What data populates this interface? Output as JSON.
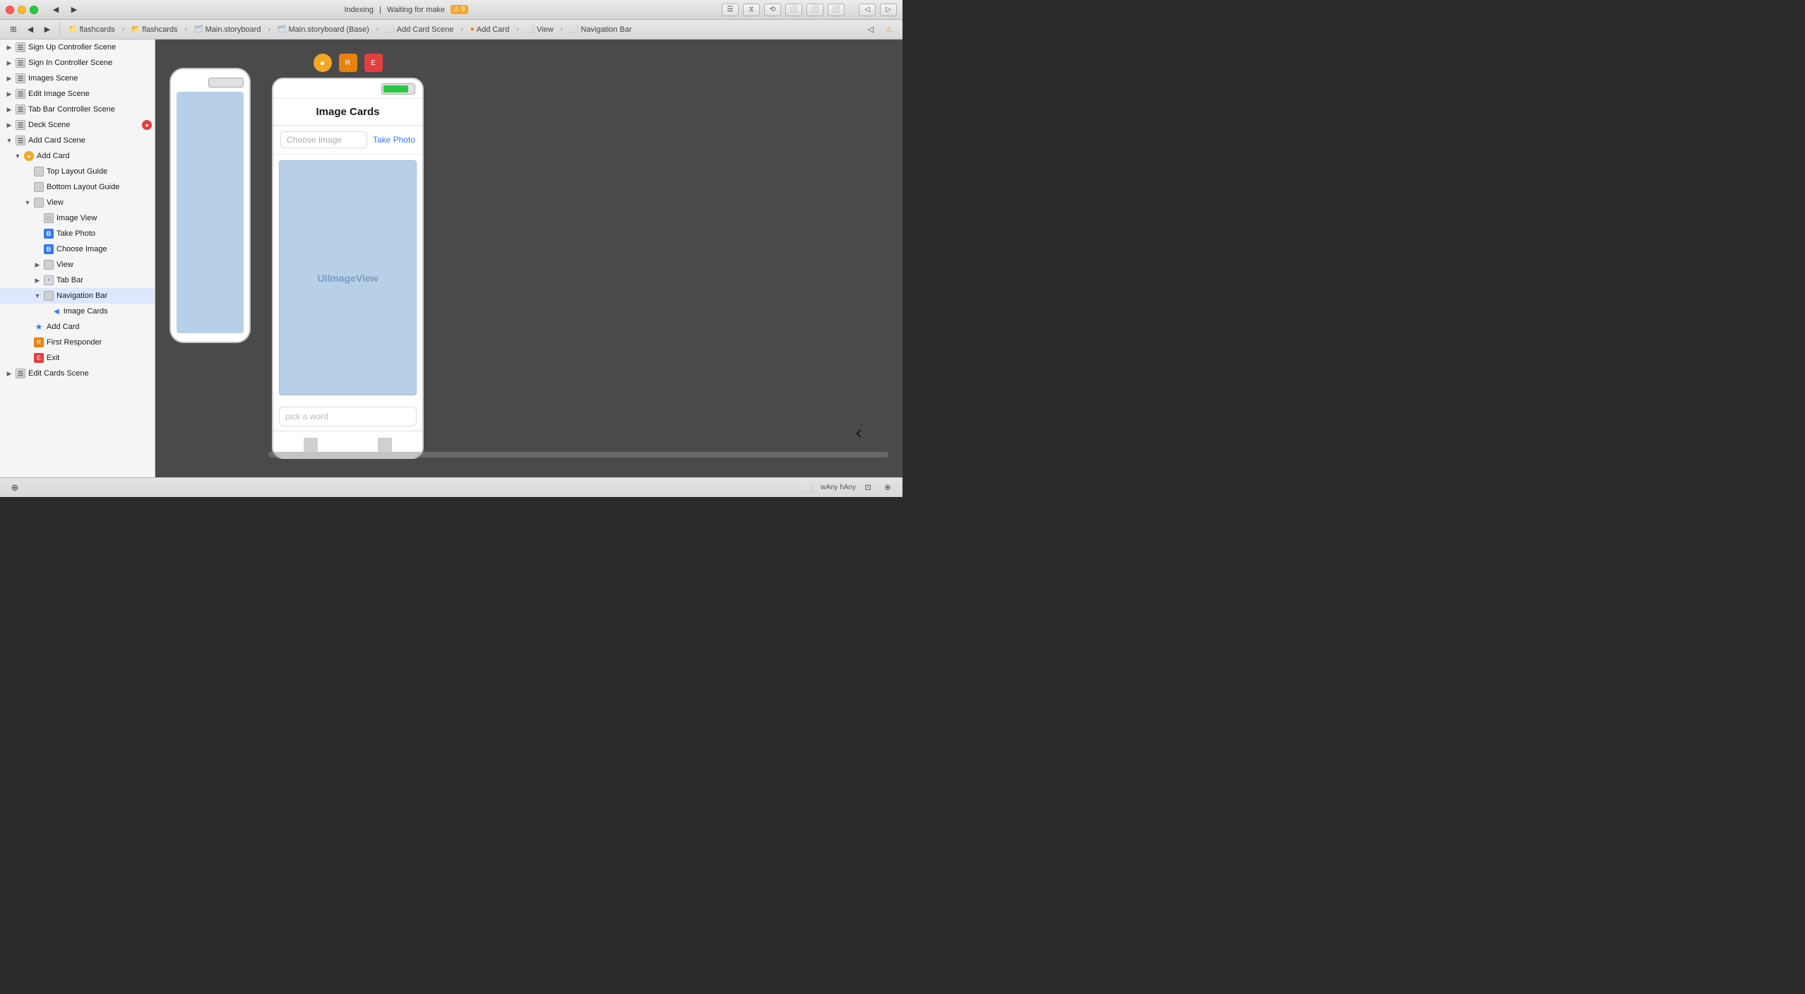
{
  "titlebar": {
    "indexing_label": "Indexing",
    "separator": "|",
    "status_label": "Waiting for make",
    "warning_count": "9",
    "traffic_lights": [
      "close",
      "minimize",
      "maximize"
    ]
  },
  "breadcrumb": {
    "items": [
      {
        "label": "flashcards",
        "type": "project"
      },
      {
        "label": "flashcards",
        "type": "folder"
      },
      {
        "label": "Main.storyboard",
        "type": "storyboard"
      },
      {
        "label": "Main.storyboard (Base)",
        "type": "storyboard-base"
      },
      {
        "label": "Add Card Scene",
        "type": "scene"
      },
      {
        "label": "Add Card",
        "type": "controller"
      },
      {
        "label": "View",
        "type": "view"
      },
      {
        "label": "Navigation Bar",
        "type": "navbar"
      }
    ]
  },
  "sidebar": {
    "scenes": [
      {
        "id": "sign-up",
        "label": "Sign Up Controller Scene",
        "level": 0,
        "expanded": false
      },
      {
        "id": "sign-in",
        "label": "Sign In Controller Scene",
        "level": 0,
        "expanded": false
      },
      {
        "id": "images",
        "label": "Images Scene",
        "level": 0,
        "expanded": false
      },
      {
        "id": "edit-image",
        "label": "Edit Image Scene",
        "level": 0,
        "expanded": false
      },
      {
        "id": "tab-bar",
        "label": "Tab Bar Controller Scene",
        "level": 0,
        "expanded": false
      },
      {
        "id": "deck",
        "label": "Deck Scene",
        "level": 0,
        "expanded": false,
        "has_badge": true
      },
      {
        "id": "add-card",
        "label": "Add Card Scene",
        "level": 0,
        "expanded": true
      },
      {
        "id": "add-card-ctrl",
        "label": "Add Card",
        "level": 1,
        "type": "controller"
      },
      {
        "id": "top-layout",
        "label": "Top Layout Guide",
        "level": 2,
        "type": "guide"
      },
      {
        "id": "bottom-layout",
        "label": "Bottom Layout Guide",
        "level": 2,
        "type": "guide"
      },
      {
        "id": "view",
        "label": "View",
        "level": 2,
        "expanded": true,
        "type": "view"
      },
      {
        "id": "image-view",
        "label": "Image View",
        "level": 3,
        "type": "view"
      },
      {
        "id": "take-photo",
        "label": "Take Photo",
        "level": 3,
        "type": "button"
      },
      {
        "id": "choose-image",
        "label": "Choose Image",
        "level": 3,
        "type": "button"
      },
      {
        "id": "view-2",
        "label": "View",
        "level": 3,
        "type": "view",
        "has_arrow": true
      },
      {
        "id": "tab-bar-2",
        "label": "Tab Bar",
        "level": 3,
        "type": "tabbar",
        "has_arrow": true
      },
      {
        "id": "nav-bar",
        "label": "Navigation Bar",
        "level": 3,
        "expanded": true,
        "type": "navctrl",
        "selected": true
      },
      {
        "id": "image-cards",
        "label": "Image Cards",
        "level": 4,
        "type": "navitem"
      },
      {
        "id": "add-card-obj",
        "label": "Add Card",
        "level": 2,
        "type": "star"
      },
      {
        "id": "first-responder",
        "label": "First Responder",
        "level": 2,
        "type": "orange"
      },
      {
        "id": "exit",
        "label": "Exit",
        "level": 2,
        "type": "red"
      },
      {
        "id": "edit-cards",
        "label": "Edit Cards Scene",
        "level": 0,
        "expanded": false
      }
    ]
  },
  "canvas": {
    "scene_title": "Image Cards",
    "image_view_label": "UIImageView",
    "choose_image_label": "Choose Image",
    "take_photo_label": "Take Photo",
    "textfield_placeholder": "pick a word",
    "size_label": "wAny hAny"
  },
  "bottom_bar": {
    "size_label": "wAny hAny",
    "icon_labels": [
      "layout-icon",
      "zoom-fit-icon",
      "zoom-icon"
    ]
  }
}
